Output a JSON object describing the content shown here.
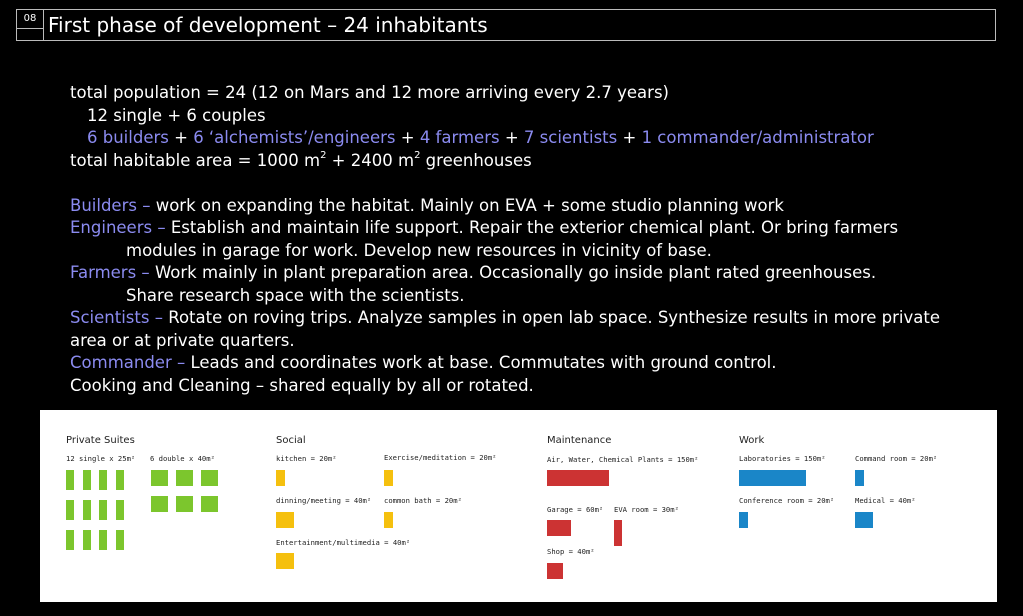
{
  "slide": {
    "number": "08",
    "title": "First phase of development – 24 inhabitants"
  },
  "summary": {
    "population": "total population = 24  (12 on Mars and 12 more arriving every 2.7 years)",
    "composition": "12 single + 6 couples",
    "roles": {
      "builders": "6 builders",
      "engineers": "6 ‘alchemists’/engineers",
      "farmers": "4 farmers",
      "scientists": "7 scientists",
      "commander": "1 commander/administrator",
      "plus": "+"
    },
    "area": {
      "prefix": "total habitable area = 1000 m",
      "middle": " + 2400 m",
      "suffix": "  greenhouses",
      "exp": "2"
    }
  },
  "roles_desc": [
    {
      "name": "Builders",
      "dash": " – ",
      "text": "work on expanding the habitat. Mainly on EVA + some studio planning work"
    },
    {
      "name": "Engineers",
      "dash": " – ",
      "text": "Establish and maintain life support. Repair the exterior chemical plant. Or bring farmers",
      "cont": "modules in garage for work. Develop new resources in vicinity of base."
    },
    {
      "name": "Farmers",
      "dash": " – ",
      "text": "Work mainly in plant preparation area. Occasionally go inside plant rated greenhouses.",
      "cont": "Share research space with the scientists."
    },
    {
      "name": "Scientists",
      "dash": " – ",
      "text": "Rotate on roving trips. Analyze samples in open lab space. Synthesize results in more private",
      "cont": "area or at private quarters."
    },
    {
      "name": "Commander",
      "dash": " – ",
      "text": "Leads and coordinates work at base. Commutates with ground control."
    }
  ],
  "cooking": "Cooking and Cleaning – shared equally by all or rotated.",
  "legend": {
    "colors": {
      "private": "#7cc62d",
      "social": "#f5c00e",
      "maintenance": "#cc3333",
      "work": "#1a86c8"
    },
    "private": {
      "heading": "Private Suites",
      "single": "12 single x 25m²",
      "double": "6 double x 40m²"
    },
    "social": {
      "heading": "Social",
      "kitchen": "kitchen = 20m²",
      "exercise": "Exercise/meditation = 20m²",
      "dinning": "dinning/meeting = 40m²",
      "bath": "common bath = 20m²",
      "entertainment": "Entertainment/multimedia = 40m²"
    },
    "maintenance": {
      "heading": "Maintenance",
      "plants": "Air, Water, Chemical Plants = 150m²",
      "garage": "Garage = 60m²",
      "eva": "EVA room = 30m²",
      "shop": "Shop = 40m²"
    },
    "work": {
      "heading": "Work",
      "labs": "Laboratories = 150m²",
      "command": "Command room = 20m²",
      "conference": "Conference room = 20m²",
      "medical": "Medical = 40m²"
    }
  }
}
